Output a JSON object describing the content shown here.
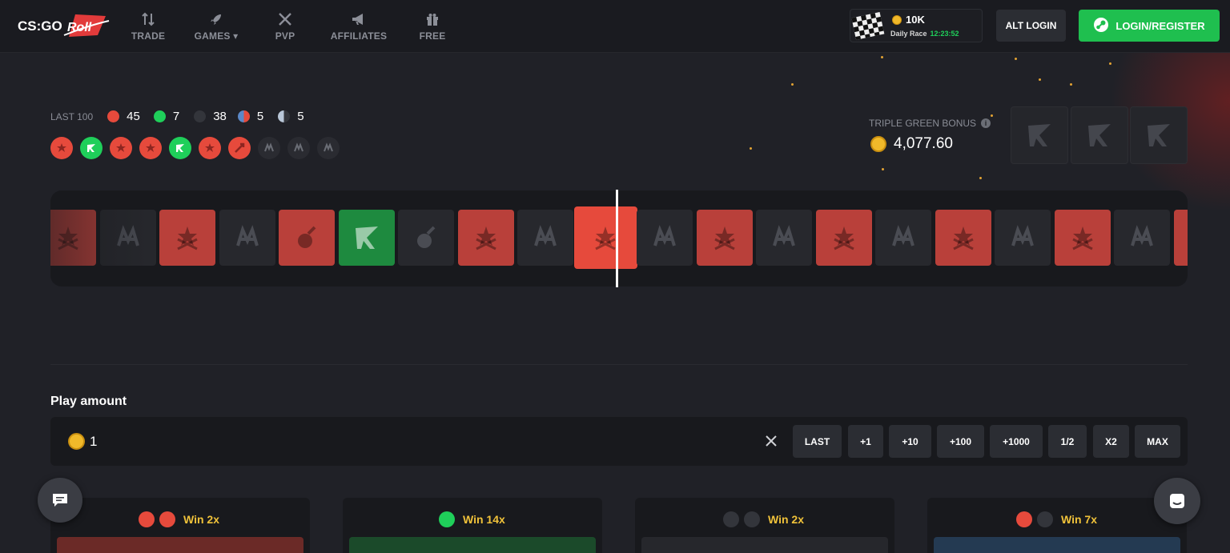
{
  "header": {
    "logo_text": "CS:GO ROLL",
    "nav": [
      {
        "label": "TRADE",
        "icon": "trade-arrows-icon"
      },
      {
        "label": "GAMES ▾",
        "icon": "rocket-icon"
      },
      {
        "label": "PVP",
        "icon": "crossed-swords-icon"
      },
      {
        "label": "AFFILIATES",
        "icon": "megaphone-icon"
      },
      {
        "label": "FREE",
        "icon": "gift-icon"
      }
    ],
    "race": {
      "amount": "10K",
      "label": "Daily Race",
      "timer": "12:23:52"
    },
    "alt_login": "ALT LOGIN",
    "login_register": "LOGIN/REGISTER"
  },
  "last100": {
    "label": "LAST 100",
    "red": "45",
    "green": "7",
    "gray": "38",
    "red_half": "5",
    "gray_half": "5"
  },
  "history": [
    "red",
    "green",
    "red",
    "red",
    "green",
    "red",
    "red-alt",
    "gray",
    "gray",
    "gray"
  ],
  "bonus": {
    "label": "TRIPLE GREEN BONUS",
    "amount": "4,077.60"
  },
  "roller": {
    "tiles": [
      "red",
      "gray",
      "red",
      "gray",
      "red-alt",
      "green",
      "gray-alt",
      "red",
      "gray",
      "red-active",
      "gray",
      "red",
      "gray",
      "red",
      "gray",
      "red",
      "gray",
      "red",
      "gray",
      "red"
    ]
  },
  "play": {
    "title": "Play amount",
    "value": "1",
    "buttons": [
      "LAST",
      "+1",
      "+10",
      "+100",
      "+1000",
      "1/2",
      "X2",
      "MAX"
    ]
  },
  "bets": [
    {
      "label": "Win 2x",
      "color": "#b9403a"
    },
    {
      "label": "Win 14x",
      "color": "#1e8a3f"
    },
    {
      "label": "Win 2x",
      "color": "#27282d"
    },
    {
      "label": "Win 7x",
      "color": "#2c4a6a"
    }
  ],
  "colors": {
    "accent_green": "#1fbf4f",
    "red": "#e64a3c",
    "gold": "#f0c23a"
  }
}
